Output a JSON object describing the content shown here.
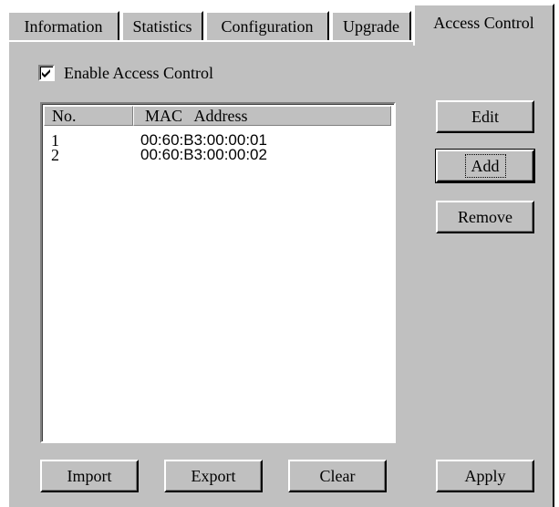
{
  "tabs": [
    {
      "label": "Information",
      "active": false
    },
    {
      "label": "Statistics",
      "active": false
    },
    {
      "label": "Configuration",
      "active": false
    },
    {
      "label": "Upgrade",
      "active": false
    },
    {
      "label": "Access Control",
      "active": true
    }
  ],
  "enable_access_control": {
    "label": "Enable Access Control",
    "checked": true
  },
  "list": {
    "columns": [
      "No.",
      "MAC   Address"
    ],
    "rows": [
      {
        "no": "1",
        "mac": "00:60:B3:00:00:01"
      },
      {
        "no": "2",
        "mac": "00:60:B3:00:00:02"
      }
    ]
  },
  "buttons": {
    "edit": "Edit",
    "add": "Add",
    "remove": "Remove",
    "import": "Import",
    "export": "Export",
    "clear": "Clear",
    "apply": "Apply"
  },
  "colors": {
    "face": "#c0c0c0",
    "highlight": "#ffffff",
    "shadow": "#808080",
    "dark_shadow": "#000000",
    "window": "#ffffff"
  }
}
